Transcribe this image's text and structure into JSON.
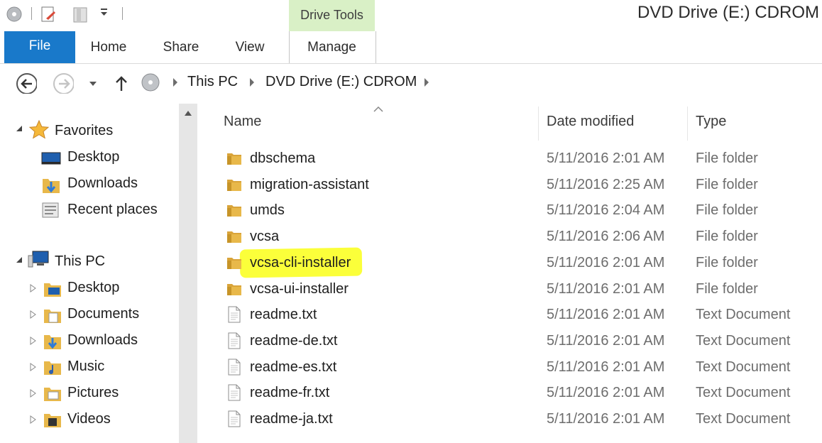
{
  "window": {
    "title": "DVD Drive (E:) CDROM",
    "context_tab": "Drive Tools"
  },
  "ribbon": {
    "tabs": [
      "File",
      "Home",
      "Share",
      "View",
      "Manage"
    ]
  },
  "address": {
    "segments": [
      "This PC",
      "DVD Drive (E:) CDROM"
    ]
  },
  "nav": {
    "favorites_label": "Favorites",
    "favorites": [
      "Desktop",
      "Downloads",
      "Recent places"
    ],
    "thispc_label": "This PC",
    "thispc": [
      "Desktop",
      "Documents",
      "Downloads",
      "Music",
      "Pictures",
      "Videos"
    ]
  },
  "columns": {
    "name": "Name",
    "date": "Date modified",
    "type": "Type"
  },
  "files": [
    {
      "name": "dbschema",
      "date": "5/11/2016 2:01 AM",
      "type": "File folder",
      "icon": "folder-icon"
    },
    {
      "name": "migration-assistant",
      "date": "5/11/2016 2:25 AM",
      "type": "File folder",
      "icon": "folder-icon"
    },
    {
      "name": "umds",
      "date": "5/11/2016 2:04 AM",
      "type": "File folder",
      "icon": "folder-icon"
    },
    {
      "name": "vcsa",
      "date": "5/11/2016 2:06 AM",
      "type": "File folder",
      "icon": "folder-icon"
    },
    {
      "name": "vcsa-cli-installer",
      "date": "5/11/2016 2:01 AM",
      "type": "File folder",
      "icon": "folder-icon",
      "highlighted": true
    },
    {
      "name": "vcsa-ui-installer",
      "date": "5/11/2016 2:01 AM",
      "type": "File folder",
      "icon": "folder-icon"
    },
    {
      "name": "readme.txt",
      "date": "5/11/2016 2:01 AM",
      "type": "Text Document",
      "icon": "text-file-icon"
    },
    {
      "name": "readme-de.txt",
      "date": "5/11/2016 2:01 AM",
      "type": "Text Document",
      "icon": "text-file-icon"
    },
    {
      "name": "readme-es.txt",
      "date": "5/11/2016 2:01 AM",
      "type": "Text Document",
      "icon": "text-file-icon"
    },
    {
      "name": "readme-fr.txt",
      "date": "5/11/2016 2:01 AM",
      "type": "Text Document",
      "icon": "text-file-icon"
    },
    {
      "name": "readme-ja.txt",
      "date": "5/11/2016 2:01 AM",
      "type": "Text Document",
      "icon": "text-file-icon"
    }
  ],
  "colors": {
    "file_tab": "#1979ca",
    "drive_tools": "#d9f0c6",
    "highlight": "#fbff3a",
    "folder": "#e8b84a"
  }
}
